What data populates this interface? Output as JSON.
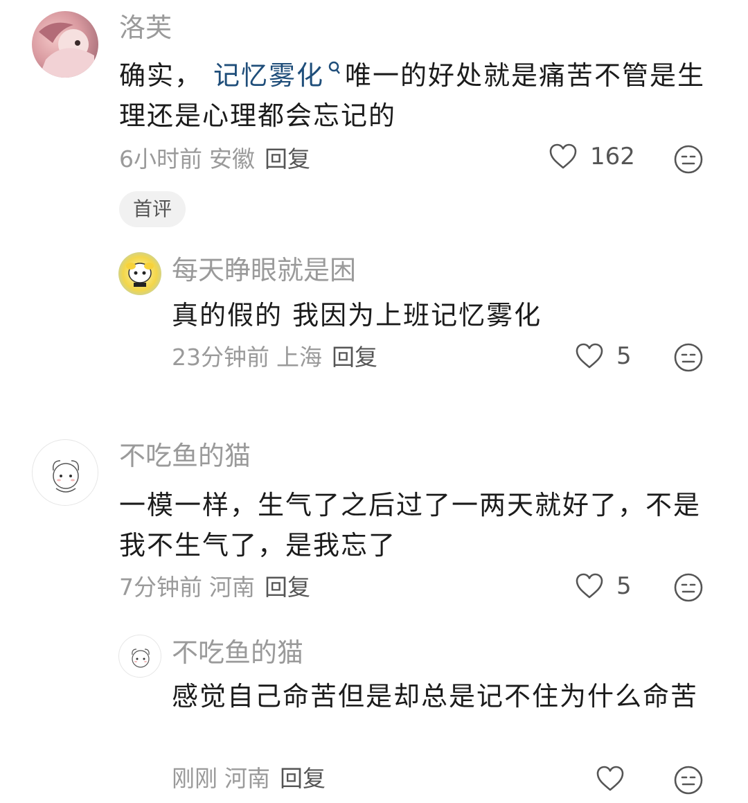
{
  "comments": [
    {
      "user": "洛芙",
      "text_before": "确实，",
      "link": "记忆雾化",
      "text_after": "唯一的好处就是痛苦不管是生理还是心理都会忘记的",
      "time": "6小时前",
      "location": "安徽",
      "reply_label": "回复",
      "likes": "162",
      "tag": "首评"
    },
    {
      "user": "每天睁眼就是困",
      "text": "真的假的 我因为上班记忆雾化",
      "time": "23分钟前",
      "location": "上海",
      "reply_label": "回复",
      "likes": "5"
    },
    {
      "user": "不吃鱼的猫",
      "text": "一模一样，生气了之后过了一两天就好了，不是我不生气了，是我忘了",
      "time": "7分钟前",
      "location": "河南",
      "reply_label": "回复",
      "likes": "5"
    },
    {
      "user": "不吃鱼的猫",
      "text": "感觉自己命苦但是却总是记不住为什么命苦",
      "time": "刚刚",
      "location": "河南",
      "reply_label": "回复",
      "likes": ""
    }
  ],
  "icons": {
    "like": "heart-outline-icon",
    "react": "meh-face-icon",
    "search": "search-icon"
  },
  "colors": {
    "link": "#1f4e7a",
    "meta": "#9a9a9a",
    "text": "#1b1b1b"
  }
}
